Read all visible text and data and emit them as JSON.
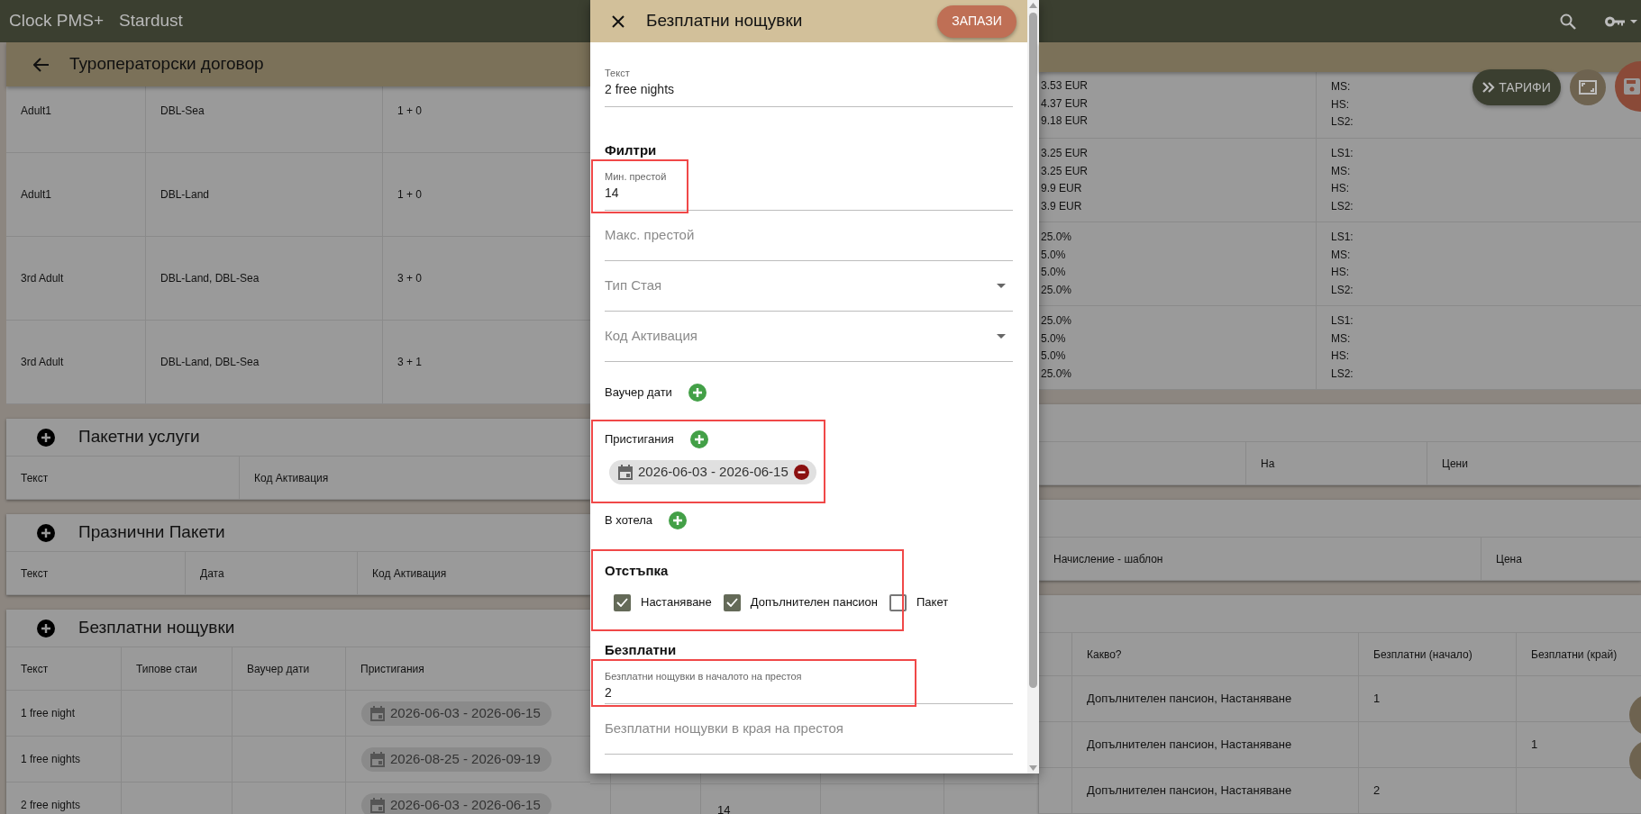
{
  "app_bar": {
    "title": "Clock PMS+",
    "hotel": "Stardust"
  },
  "page": {
    "title": "Туроператорски договор",
    "rates_button": "ТАРИФИ"
  },
  "rates_table": {
    "rows": [
      {
        "column_1": "Adult1",
        "column_2": "DBL-Sea",
        "column_3": "1 + 0",
        "column_4": [
          "3.53 EUR",
          "4.37 EUR",
          "9.18 EUR"
        ],
        "column_5": [
          "MS:",
          "HS:",
          "LS2:"
        ]
      },
      {
        "column_1": "Adult1",
        "column_2": "DBL-Land",
        "column_3": "1 + 0",
        "column_4": [
          "3.25 EUR",
          "3.25 EUR",
          "9.9 EUR",
          "3.9 EUR"
        ],
        "column_5": [
          "LS1:",
          "MS:",
          "HS:",
          "LS2:"
        ]
      },
      {
        "column_1": "3rd Adult",
        "column_2": "DBL-Land, DBL-Sea",
        "column_3": "3 + 0",
        "column_4": [
          "25.0%",
          "5.0%",
          "5.0%",
          "25.0%"
        ],
        "column_5": [
          "LS1:",
          "MS:",
          "HS:",
          "LS2:"
        ]
      },
      {
        "column_1": "3rd Adult",
        "column_2": "DBL-Land, DBL-Sea",
        "column_3": "3 + 1",
        "column_4": [
          "25.0%",
          "5.0%",
          "5.0%",
          "25.0%"
        ],
        "column_5": [
          "LS1:",
          "MS:",
          "HS:",
          "LS2:"
        ]
      }
    ]
  },
  "sections": [
    {
      "title": "Пакетни услуги",
      "columns": [
        "Текст",
        "Код Активация",
        "На",
        "Цени"
      ]
    },
    {
      "title": "Празнични Пакети",
      "columns": [
        "Текст",
        "Дата",
        "Код Активация",
        "Начисление - шаблон",
        "Цена"
      ]
    },
    {
      "title": "Безплатни нощувки",
      "columns": [
        "Текст",
        "Типове стаи",
        "Ваучер дати",
        "Пристигания",
        "Какво?",
        "Безплатни (начало)",
        "Безплатни (край)"
      ],
      "rows": [
        {
          "text": "1 free night",
          "arrivals": "2026-06-03 - 2026-06-15",
          "what": "Допълнителен пансион, Настаняване",
          "free_start": "1"
        },
        {
          "text": "1 free nights",
          "arrivals": "2026-08-25 - 2026-09-19",
          "what": "Допълнителен пансион, Настаняване",
          "free_end": "1"
        },
        {
          "text": "2 free nights",
          "arrivals": "2026-06-03 - 2026-06-15",
          "min_stay": "14",
          "what": "Допълнителен пансион, Настаняване",
          "free_start": "2"
        }
      ]
    }
  ],
  "dialog": {
    "title": "Безплатни нощувки",
    "save_button": "ЗАПАЗИ",
    "items": [
      {
        "kind": "field",
        "label": "Текст",
        "value": "2 free nights",
        "highlighted": false
      },
      {
        "kind": "heading",
        "text": "Филтри"
      },
      {
        "kind": "field",
        "label": "Мин. престой",
        "value": "14",
        "highlighted": true
      },
      {
        "kind": "field",
        "label": "Макс. престой",
        "highlighted": false
      },
      {
        "kind": "select",
        "label": "Тип Стая"
      },
      {
        "kind": "select",
        "label": "Код Активация"
      },
      {
        "kind": "date_list",
        "label": "Ваучер дати",
        "highlighted": false
      },
      {
        "kind": "date_list",
        "label": "Пристигания",
        "ranges": [
          "2026-06-03 - 2026-06-15"
        ],
        "highlighted": true
      },
      {
        "kind": "date_list",
        "label": "В хотела",
        "highlighted": false
      },
      {
        "kind": "checkboxes",
        "title": "Отстъпка",
        "highlighted": true,
        "options": [
          {
            "label": "Настаняване",
            "checked": true
          },
          {
            "label": "Допълнителен пансион",
            "checked": true
          },
          {
            "label": "Пакет",
            "checked": false
          }
        ]
      },
      {
        "kind": "heading",
        "text": "Безплатни"
      },
      {
        "kind": "field",
        "label": "Безплатни нощувки в началото на престоя",
        "value": "2",
        "highlighted": true
      },
      {
        "kind": "field",
        "label": "Безплатни нощувки в края на престоя",
        "highlighted": false
      }
    ]
  }
}
